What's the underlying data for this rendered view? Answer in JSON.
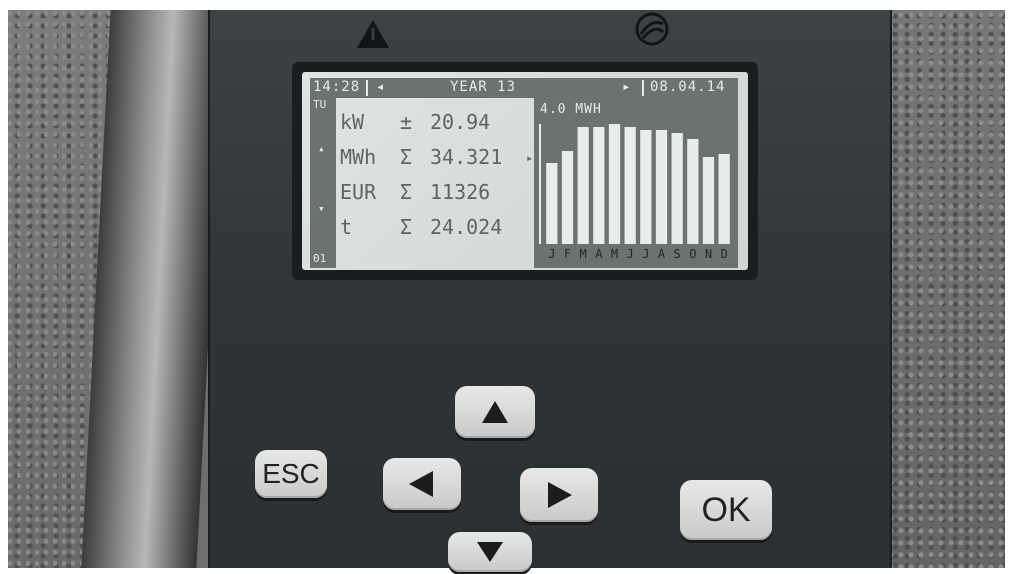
{
  "screen": {
    "time": "14:28",
    "nav_left": "◂",
    "title": "YEAR 13",
    "nav_right": "▸",
    "date": "08.04.14",
    "sidebar": {
      "top": "TU",
      "up": "▴",
      "down": "▾",
      "page": "01"
    },
    "rows": [
      {
        "unit": "kW",
        "sym": "±",
        "value": "20.94"
      },
      {
        "unit": "MWh",
        "sym": "Σ",
        "value": "34.321"
      },
      {
        "unit": "EUR",
        "sym": "Σ",
        "value": "11326"
      },
      {
        "unit": "t",
        "sym": "Σ",
        "value": "24.024"
      }
    ],
    "cursor": "▸",
    "chart_data": {
      "type": "bar",
      "title": "4.0 MWH",
      "categories": [
        "J",
        "F",
        "M",
        "A",
        "M",
        "J",
        "J",
        "A",
        "S",
        "O",
        "N",
        "D"
      ],
      "month_labels": "JFMAMJJASOND",
      "values": [
        2.7,
        3.1,
        3.9,
        3.9,
        4.0,
        3.9,
        3.8,
        3.8,
        3.7,
        3.5,
        2.9,
        3.0
      ],
      "ylim": [
        0,
        4.0
      ],
      "bar_color": "#e8ecea",
      "bg_color": "#6b7372"
    }
  },
  "buttons": {
    "esc": "ESC",
    "ok": "OK",
    "up": "up-arrow",
    "left": "left-arrow",
    "right": "right-arrow",
    "down": "down-arrow"
  },
  "colors": {
    "housing": "#2f3436",
    "lcd": "#d8dedc",
    "button": "#dcdcda"
  }
}
